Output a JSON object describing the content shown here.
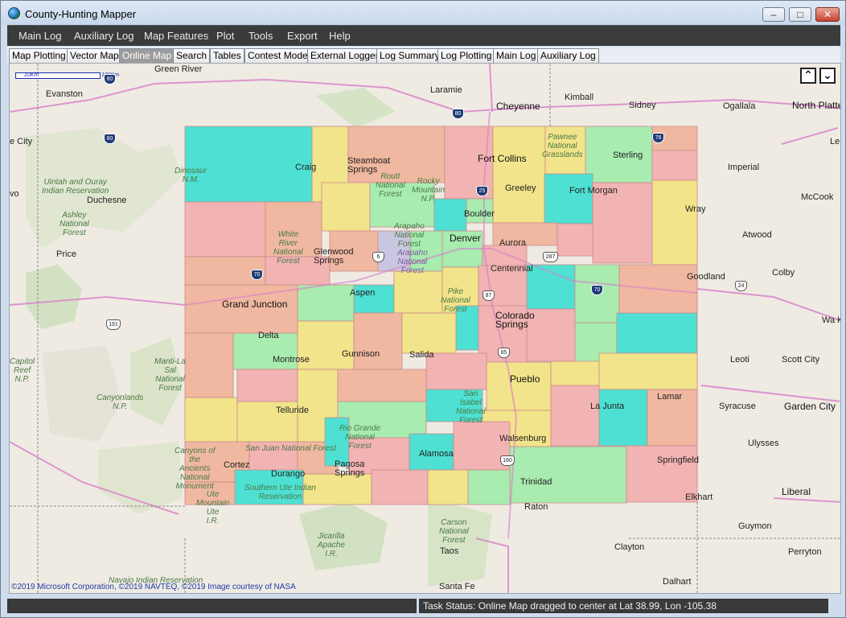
{
  "window": {
    "title": "County-Hunting Mapper",
    "minimize": "–",
    "maximize": "□",
    "close": "✕"
  },
  "menu": [
    "Main Log",
    "Auxiliary Log",
    "Map Features",
    "Plot",
    "Tools",
    "Export",
    "Help"
  ],
  "tabs": [
    "Map Plotting",
    "Vector Map",
    "Online Map",
    "Search",
    "Tables",
    "Contest Mode",
    "External Logger",
    "Log Summary",
    "Log Plotting",
    "Main Log",
    "Auxiliary Log"
  ],
  "active_tab": "Online Map",
  "map": {
    "scale_left": "10Km",
    "scale_right": "100Km",
    "up_label": "⌃",
    "down_label": "⌄",
    "copyright": "©2019 Microsoft Corporation, ©2019 NAVTEQ, ©2019 Image courtesy of NASA",
    "colors": {
      "cyan": "#4ee0d2",
      "yellow": "#f2e48a",
      "pink": "#f2b3b3",
      "green": "#a8ecb0",
      "salmon": "#f0b8a0"
    },
    "labels": {
      "green_river": "Green River",
      "laramie": "Laramie",
      "cheyenne": "Cheyenne",
      "kimball": "Kimball",
      "sidney": "Sidney",
      "ogallala": "Ogallala",
      "north_platte": "North Platte",
      "evanston": "Evanston",
      "e_city": "e City",
      "le": "Le",
      "dinosaur": "Dinosaur\nN.M.",
      "craig": "Craig",
      "steamboat": "Steamboat\nSprings",
      "routt": "Routt\nNational\nForest",
      "rocky": "Rocky\nMountain\nN.P.",
      "fort_collins": "Fort Collins",
      "pawnee": "Pawnee\nNational\nGrasslands",
      "sterling": "Sterling",
      "imperial": "Imperial",
      "uintah": "Uintah and Ouray\nIndian Reservation",
      "duchesne": "Duchesne",
      "vo": "vo",
      "greeley": "Greeley",
      "fort_morgan": "Fort Morgan",
      "mccook": "McCook",
      "ashley": "Ashley\nNational\nForest",
      "boulder": "Boulder",
      "arapaho": "Arapaho\nNational\nForest",
      "wray": "Wray",
      "white_river": "White\nRiver\nNational\nForest",
      "denver": "Denver",
      "aurora": "Aurora",
      "atwood": "Atwood",
      "price": "Price",
      "glenwood": "Glenwood\nSprings",
      "arapaho2": "Arapaho\nNational\nForest",
      "centennial": "Centennial",
      "goodland": "Goodland",
      "colby": "Colby",
      "grand_junction": "Grand Junction",
      "aspen": "Aspen",
      "pike": "Pike\nNational\nForest",
      "colorado_springs": "Colorado\nSprings",
      "wa_ke": "Wa Ke",
      "delta": "Delta",
      "gunnison": "Gunnison",
      "salida": "Salida",
      "leoti": "Leoti",
      "scott_city": "Scott City",
      "capitol_reef": "Capitol\nReef\nN.P.",
      "montrose": "Montrose",
      "manti": "Manti-La\nSal\nNational\nForest",
      "pueblo": "Pueblo",
      "canyonlands": "Canyonlands\nN.P.",
      "lamar": "Lamar",
      "telluride": "Telluride",
      "san_isabel": "San\nIsabel\nNational\nForest",
      "la_junta": "La Junta",
      "syracuse": "Syracuse",
      "garden_city": "Garden City",
      "rio_grande": "Rio Grande\nNational\nForest",
      "canyons": "Canyons of\nthe\nAncients\nNational\nMonument",
      "san_juan": "San Juan National Forest",
      "walsenburg": "Walsenburg",
      "ulysses": "Ulysses",
      "alamosa": "Alamosa",
      "cortez": "Cortez",
      "durango": "Durango",
      "pagosa": "Pagosa\nSprings",
      "ute": "Ute\nMountain\nUte\nI.R.",
      "southern_ute": "Southern Ute Indian\nReservation",
      "trinidad": "Trinidad",
      "springfield": "Springfield",
      "elkhart": "Elkhart",
      "liberal": "Liberal",
      "raton": "Raton",
      "carson": "Carson\nNational\nForest",
      "guymon": "Guymon",
      "jicarilla": "Jicarilla\nApache\nI.R.",
      "taos": "Taos",
      "clayton": "Clayton",
      "perryton": "Perryton",
      "navajo": "Navajo Indian Reservation",
      "dalhart": "Dalhart",
      "santa_fe": "Santa Fe"
    },
    "shields": {
      "i80a": "80",
      "i80b": "80",
      "i80c": "80",
      "i25a": "25",
      "i76": "76",
      "i70a": "70",
      "i70b": "70",
      "us6": "6",
      "us287": "287",
      "us24": "24",
      "us191": "191",
      "us87": "87",
      "us85": "85",
      "us160": "160"
    }
  },
  "status": {
    "left": "",
    "right": "Task Status: Online Map dragged to center at Lat 38.99, Lon -105.38"
  }
}
